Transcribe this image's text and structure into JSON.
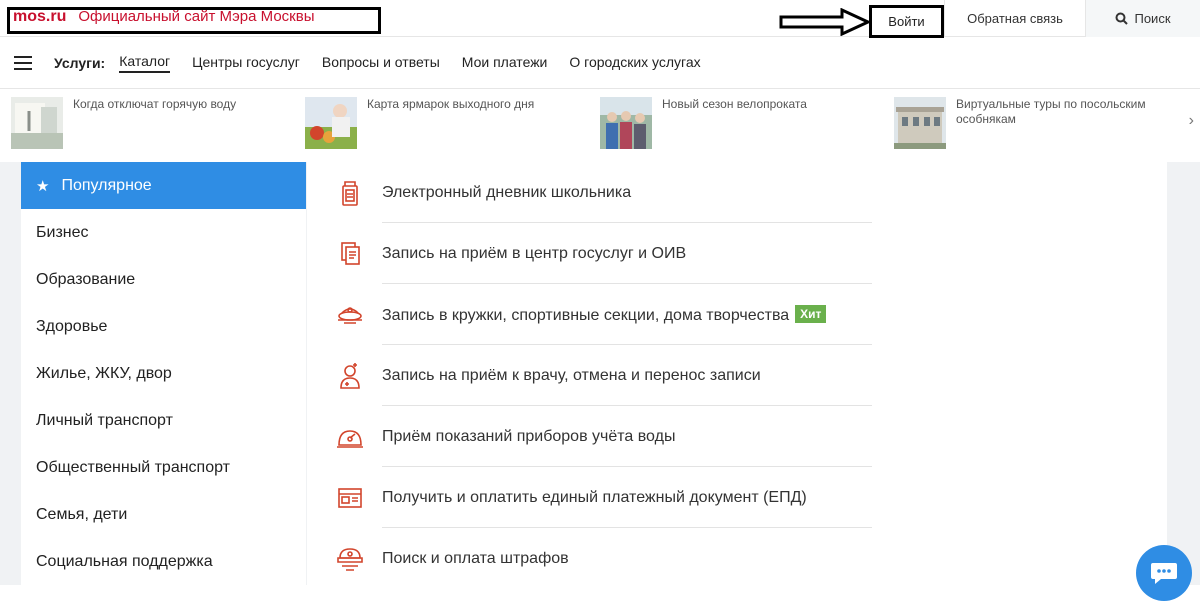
{
  "header": {
    "logo": "mos.ru",
    "subtitle": "Официальный сайт Мэра Москвы",
    "login_label": "Войти",
    "feedback_label": "Обратная связь",
    "search_label": "Поиск"
  },
  "nav": {
    "label": "Услуги:",
    "items": [
      {
        "label": "Каталог",
        "active": true
      },
      {
        "label": "Центры госуслуг"
      },
      {
        "label": "Вопросы и ответы"
      },
      {
        "label": "Мои платежи"
      },
      {
        "label": "О городских услугах"
      }
    ]
  },
  "news": [
    {
      "text": "Когда отключат горячую воду"
    },
    {
      "text": "Карта ярмарок выходного дня"
    },
    {
      "text": "Новый сезон велопроката"
    },
    {
      "text": "Виртуальные туры по посольским особнякам"
    }
  ],
  "sidebar": {
    "items": [
      {
        "label": "Популярное",
        "active": true
      },
      {
        "label": "Бизнес"
      },
      {
        "label": "Образование"
      },
      {
        "label": "Здоровье"
      },
      {
        "label": "Жилье, ЖКУ, двор"
      },
      {
        "label": "Личный транспорт"
      },
      {
        "label": "Общественный транспорт"
      },
      {
        "label": "Семья, дети"
      },
      {
        "label": "Социальная поддержка"
      }
    ]
  },
  "services": {
    "items": [
      {
        "label": "Электронный дневник школьника",
        "icon": "diary-icon"
      },
      {
        "label": "Запись на приём в центр госуслуг и ОИВ",
        "icon": "document-icon"
      },
      {
        "label": "Запись в кружки, спортивные секции, дома творчества",
        "icon": "club-icon",
        "badge": "Хит"
      },
      {
        "label": "Запись на приём к врачу, отмена и перенос записи",
        "icon": "doctor-icon"
      },
      {
        "label": "Приём показаний приборов учёта воды",
        "icon": "water-meter-icon"
      },
      {
        "label": "Получить и оплатить единый платежный документ (ЕПД)",
        "icon": "payment-document-icon"
      },
      {
        "label": "Поиск и оплата штрафов",
        "icon": "police-cap-icon"
      }
    ]
  },
  "colors": {
    "brand_red": "#c8102e",
    "accent_blue": "#2f8de4",
    "hit_green": "#6ab04c"
  }
}
